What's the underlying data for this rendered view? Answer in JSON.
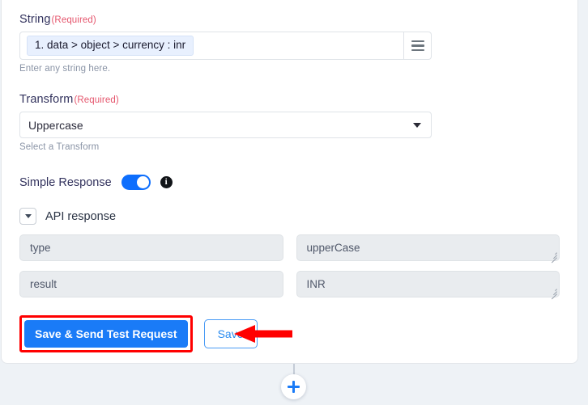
{
  "form": {
    "string_field": {
      "label": "String",
      "required_tag": "(Required)",
      "token": "1. data > object > currency : inr",
      "helper": "Enter any string here.",
      "menu_icon": "hamburger-icon"
    },
    "transform_field": {
      "label": "Transform",
      "required_tag": "(Required)",
      "value": "Uppercase",
      "helper": "Select a Transform"
    },
    "simple_response": {
      "label": "Simple Response",
      "state": "on",
      "info_glyph": "i"
    }
  },
  "api_response": {
    "title": "API response",
    "collapse_icon": "chevron-down-icon",
    "rows": [
      {
        "key": "type",
        "value": "upperCase"
      },
      {
        "key": "result",
        "value": "INR"
      }
    ]
  },
  "actions": {
    "primary_label": "Save & Send Test Request",
    "secondary_label": "Save",
    "highlight_color": "#ff0000",
    "primary_color": "#1a7bf7"
  },
  "flow": {
    "add_step_icon": "plus-icon"
  }
}
